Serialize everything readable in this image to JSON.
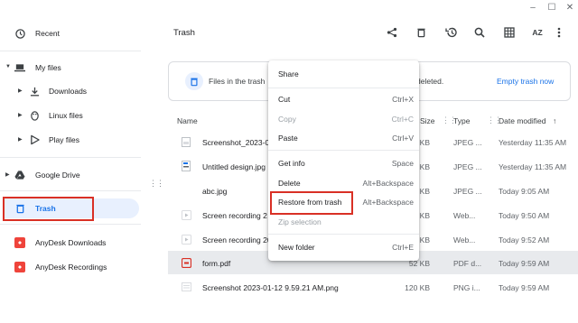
{
  "window": {
    "minimize": "–",
    "maximize": "☐",
    "close": "✕"
  },
  "sidebar": {
    "items": [
      {
        "label": "Recent",
        "icon": "clock-icon"
      },
      {
        "label": "My files",
        "icon": "laptop-icon"
      },
      {
        "label": "Downloads",
        "icon": "download-icon"
      },
      {
        "label": "Linux files",
        "icon": "linux-penguin-icon"
      },
      {
        "label": "Play files",
        "icon": "play-store-icon"
      },
      {
        "label": "Google Drive",
        "icon": "google-drive-icon"
      },
      {
        "label": "Trash",
        "icon": "trash-icon"
      },
      {
        "label": "AnyDesk Downloads",
        "icon": "anydesk-icon"
      },
      {
        "label": "AnyDesk Recordings",
        "icon": "anydesk-icon"
      }
    ]
  },
  "header": {
    "title": "Trash",
    "tools": [
      "share-icon",
      "delete-icon",
      "restore-icon",
      "search-icon",
      "grid-view-icon",
      "sort-az-icon",
      "more-vert-icon"
    ],
    "sort_label": "AZ"
  },
  "banner": {
    "text": "Files in the trash",
    "text_end": "deleted.",
    "link": "Empty trash now"
  },
  "columns": {
    "name": "Name",
    "size": "Size",
    "type": "Type",
    "date": "Date modified"
  },
  "files": [
    {
      "name": "Screenshot_2023-0",
      "size": "KB",
      "type": "JPEG ...",
      "date": "Yesterday 11:35 AM",
      "icon": "image-icon"
    },
    {
      "name": "Untitled design.jpg",
      "size": "KB",
      "type": "JPEG ...",
      "date": "Yesterday 11:35 AM",
      "icon": "image-icon"
    },
    {
      "name": "abc.jpg",
      "size": "KB",
      "type": "JPEG ...",
      "date": "Today 9:05 AM",
      "icon": "image-icon"
    },
    {
      "name": "Screen recording 2",
      "size": "KB",
      "type": "Web...",
      "date": "Today 9:50 AM",
      "icon": "video-icon"
    },
    {
      "name": "Screen recording 20",
      "size": "KB",
      "type": "Web...",
      "date": "Today 9:52 AM",
      "icon": "video-icon"
    },
    {
      "name": "form.pdf",
      "size": "52 KB",
      "type": "PDF d...",
      "date": "Today 9:59 AM",
      "icon": "pdf-icon"
    },
    {
      "name": "Screenshot 2023-01-12 9.59.21 AM.png",
      "size": "120 KB",
      "type": "PNG i...",
      "date": "Today 9:59 AM",
      "icon": "image-icon"
    }
  ],
  "context_menu": {
    "share": {
      "label": "Share"
    },
    "cut": {
      "label": "Cut",
      "shortcut": "Ctrl+X"
    },
    "copy": {
      "label": "Copy",
      "shortcut": "Ctrl+C"
    },
    "paste": {
      "label": "Paste",
      "shortcut": "Ctrl+V"
    },
    "get_info": {
      "label": "Get info",
      "shortcut": "Space"
    },
    "delete": {
      "label": "Delete",
      "shortcut": "Alt+Backspace"
    },
    "restore": {
      "label": "Restore from trash",
      "shortcut": "Alt+Backspace"
    },
    "zip": {
      "label": "Zip selection"
    },
    "new_folder": {
      "label": "New folder",
      "shortcut": "Ctrl+E"
    }
  },
  "colors": {
    "accent": "#1a73e8",
    "selected_bg": "#e8f0fe",
    "highlight": "#d93025",
    "anydesk": "#ef443b"
  }
}
